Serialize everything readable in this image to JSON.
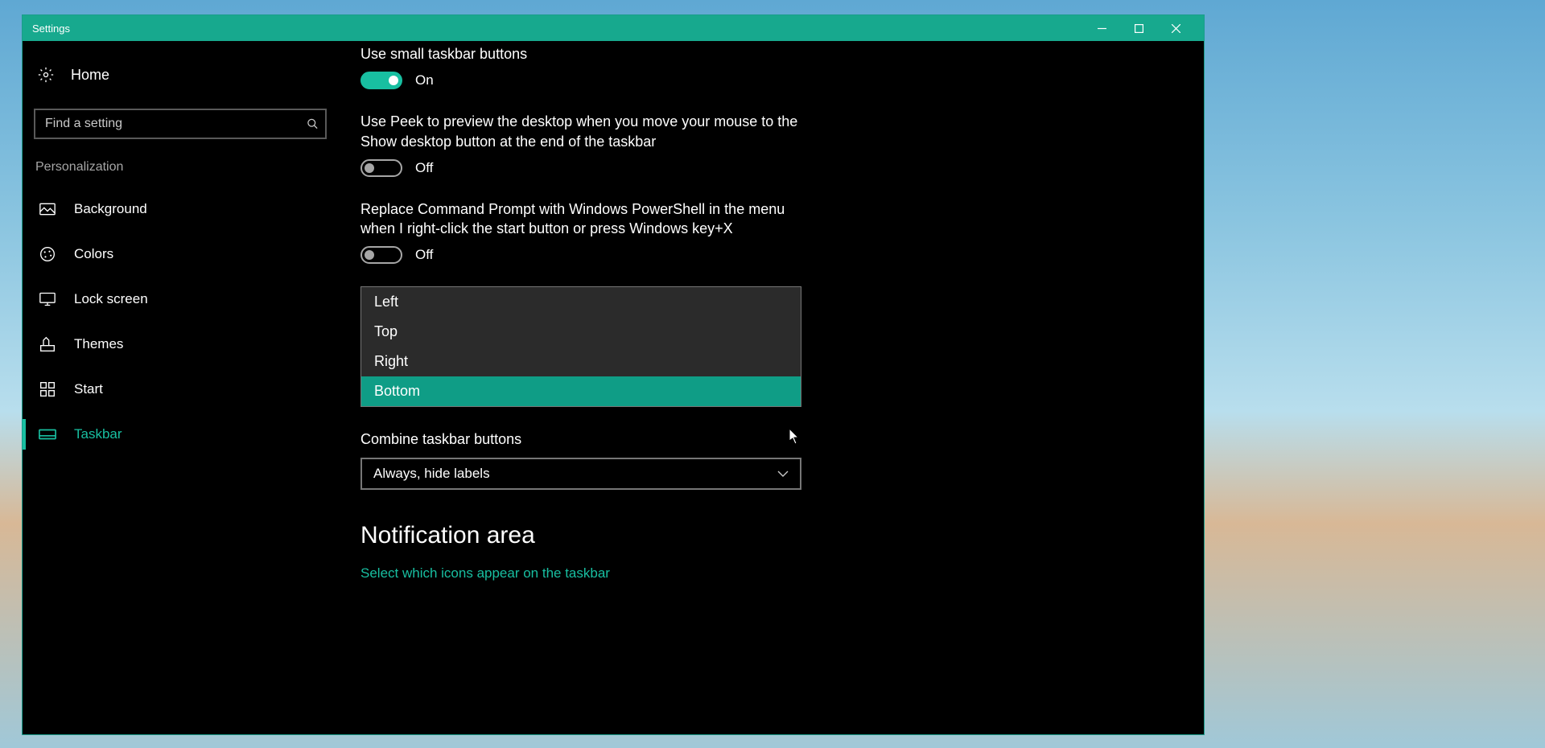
{
  "window": {
    "title": "Settings"
  },
  "sidebar": {
    "home": "Home",
    "search_placeholder": "Find a setting",
    "group": "Personalization",
    "items": [
      {
        "label": "Background"
      },
      {
        "label": "Colors"
      },
      {
        "label": "Lock screen"
      },
      {
        "label": "Themes"
      },
      {
        "label": "Start"
      },
      {
        "label": "Taskbar"
      }
    ]
  },
  "settings": {
    "small_buttons": {
      "label": "Use small taskbar buttons",
      "state": "On"
    },
    "peek": {
      "label": "Use Peek to preview the desktop when you move your mouse to the Show desktop button at the end of the taskbar",
      "state": "Off"
    },
    "powershell": {
      "label": "Replace Command Prompt with Windows PowerShell in the menu when I right-click the start button or press Windows key+X",
      "state": "Off"
    },
    "location_dropdown": {
      "options": [
        "Left",
        "Top",
        "Right",
        "Bottom"
      ],
      "selected": "Bottom"
    },
    "combine": {
      "label": "Combine taskbar buttons",
      "value": "Always, hide labels"
    },
    "notification": {
      "heading": "Notification area",
      "link": "Select which icons appear on the taskbar"
    }
  }
}
